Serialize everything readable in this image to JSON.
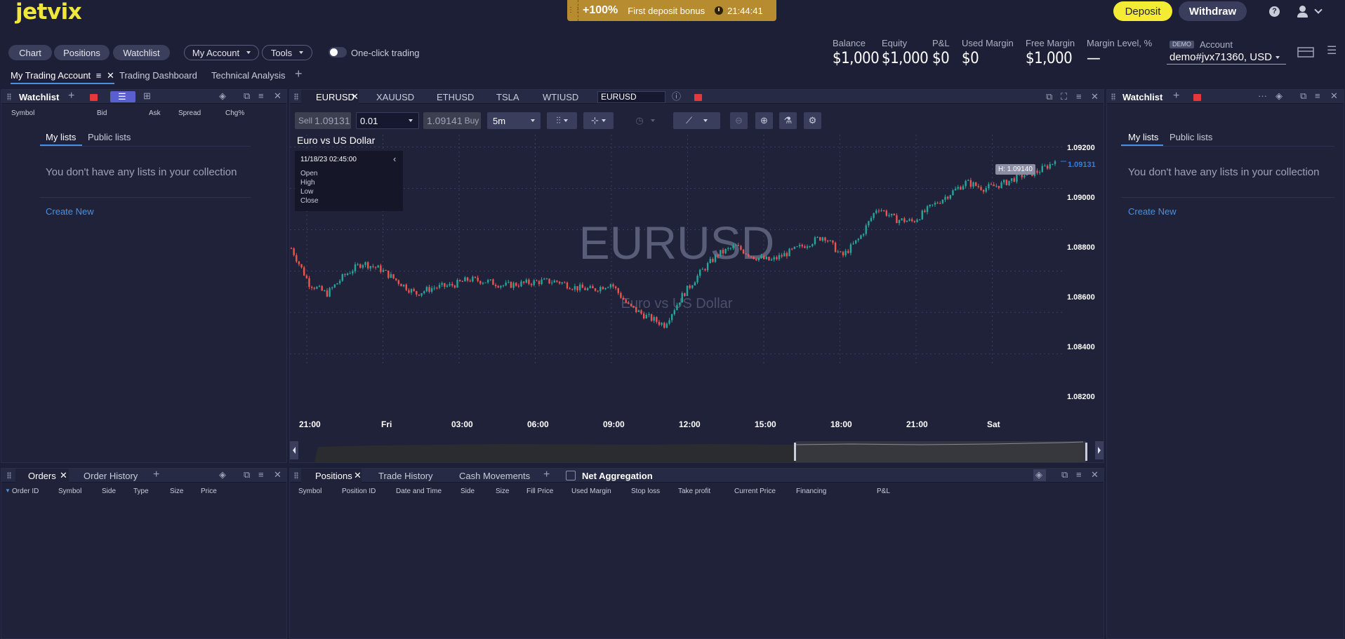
{
  "brand": {
    "logo": "jetvix"
  },
  "promo": {
    "percent": "+100%",
    "text": "First deposit bonus",
    "timer": "21:44:41"
  },
  "header_actions": {
    "deposit": "Deposit",
    "withdraw": "Withdraw"
  },
  "nav": {
    "chart": "Chart",
    "positions": "Positions",
    "watchlist": "Watchlist",
    "my_account": "My Account",
    "tools": "Tools",
    "one_click": "One-click trading"
  },
  "stats": {
    "balance_label": "Balance",
    "balance": "$1,000",
    "equity_label": "Equity",
    "equity": "$1,000",
    "pnl_label": "P&L",
    "pnl": "$0",
    "used_margin_label": "Used Margin",
    "used_margin": "$0",
    "free_margin_label": "Free Margin",
    "free_margin": "$1,000",
    "margin_level_label": "Margin Level, %",
    "margin_level": "—",
    "demo_tag": "DEMO",
    "account_label": "Account",
    "account": "demo#jvx71360, USD"
  },
  "workspace_tabs": [
    "My Trading Account",
    "Trading Dashboard",
    "Technical Analysis"
  ],
  "left_watchlist": {
    "title": "Watchlist",
    "columns": [
      "Symbol",
      "Bid",
      "Ask",
      "Spread",
      "Chg%"
    ],
    "tabs": [
      "My lists",
      "Public lists"
    ],
    "empty": "You don't have any lists in your collection",
    "create": "Create New"
  },
  "right_watchlist": {
    "title": "Watchlist",
    "tabs": [
      "My lists",
      "Public lists"
    ],
    "empty": "You don't have any lists in your collection",
    "create": "Create New"
  },
  "chart_panel": {
    "symbol_tabs": [
      "EURUSD",
      "XAUUSD",
      "ETHUSD",
      "TSLA",
      "WTIUSD"
    ],
    "search_value": "EURUSD",
    "sell_label": "Sell",
    "sell_price": "1.09131",
    "quantity": "0.01",
    "buy_price": "1.09141",
    "buy_label": "Buy",
    "timeframe": "5m",
    "title": "Euro vs US Dollar",
    "watermark": "EURUSD",
    "watermark_sub": "Euro vs US Dollar",
    "info_date": "11/18/23 02:45:00",
    "info_rows": [
      "Open",
      "High",
      "Low",
      "Close"
    ],
    "high_marker": "H: 1.09140",
    "last_price": "1.09131",
    "colors": {
      "up": "#26a69a",
      "down": "#ef5350",
      "last": "#2f7fe0"
    }
  },
  "chart_data": {
    "type": "candlestick",
    "title": "Euro vs US Dollar",
    "x_ticks": [
      "21:00",
      "Fri",
      "03:00",
      "06:00",
      "09:00",
      "12:00",
      "15:00",
      "18:00",
      "21:00",
      "Sat"
    ],
    "y_ticks": [
      "1.09200",
      "1.09000",
      "1.08800",
      "1.08600",
      "1.08400",
      "1.08200"
    ],
    "ylim": [
      1.0814,
      1.0926
    ],
    "approx_close_path": [
      1.0871,
      1.0854,
      1.0849,
      1.0858,
      1.0864,
      1.0861,
      1.0855,
      1.0849,
      1.0852,
      1.0853,
      1.0856,
      1.0855,
      1.0853,
      1.0854,
      1.0855,
      1.0855,
      1.0852,
      1.0851,
      1.0854,
      1.0843,
      1.0838,
      1.0834,
      1.0848,
      1.0859,
      1.0868,
      1.0872,
      1.0867,
      1.0865,
      1.0869,
      1.0873,
      1.0877,
      1.0867,
      1.0876,
      1.0891,
      1.0885,
      1.0884,
      1.0891,
      1.0897,
      1.0903,
      1.09,
      1.0902,
      1.0906,
      1.0908,
      1.0913
    ],
    "last": 1.09131,
    "high": 1.0914
  },
  "orders_panel": {
    "tabs": [
      "Orders",
      "Order History"
    ],
    "columns": [
      "Order ID",
      "Symbol",
      "Side",
      "Type",
      "Size",
      "Price"
    ]
  },
  "positions_panel": {
    "tabs": [
      "Positions",
      "Trade History",
      "Cash Movements"
    ],
    "net_aggregation": "Net Aggregation",
    "columns": [
      "Symbol",
      "Position ID",
      "Date and Time",
      "Side",
      "Size",
      "Fill Price",
      "Used Margin",
      "Stop loss",
      "Take profit",
      "Current Price",
      "Financing",
      "P&L"
    ]
  }
}
